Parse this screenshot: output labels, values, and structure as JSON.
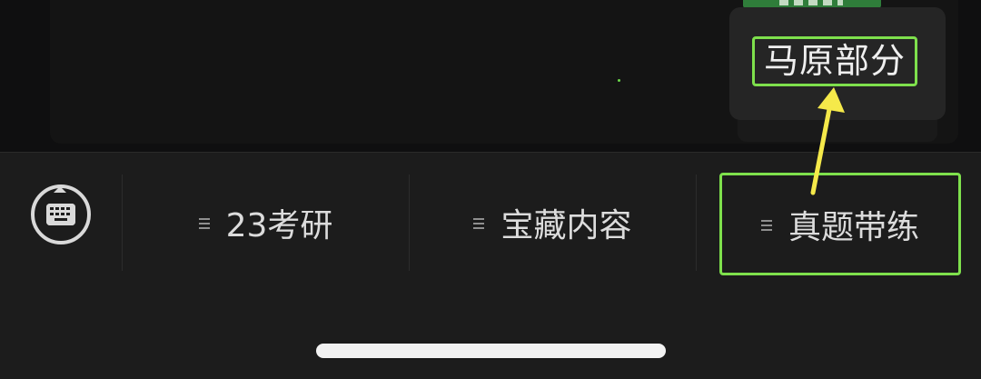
{
  "submenu": {
    "item_label": "马原部分"
  },
  "menubar": {
    "keyboard_icon": "keyboard-icon",
    "tabs": [
      {
        "label": "23考研",
        "icon": "menu-lines-icon"
      },
      {
        "label": "宝藏内容",
        "icon": "menu-lines-icon"
      },
      {
        "label": "真题带练",
        "icon": "menu-lines-icon"
      }
    ]
  },
  "colors": {
    "highlight": "#7ee04c",
    "arrow": "#f5e94a",
    "background": "#1c1c1c"
  }
}
